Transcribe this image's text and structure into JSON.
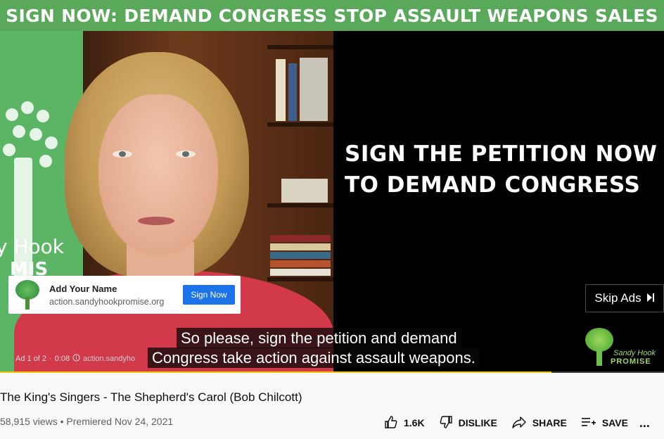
{
  "video": {
    "banner": "SIGN NOW: DEMAND CONGRESS STOP ASSAULT WEAPONS SALES",
    "petition_line1": "SIGN THE PETITION NOW",
    "petition_line2": "TO DEMAND CONGRESS",
    "panel_text1": "y Hook",
    "panel_text2": "MIS",
    "captions": [
      "So please, sign the petition and demand",
      "Congress take action against assault weapons."
    ],
    "progress": 0.83,
    "ad_info": {
      "counter": "Ad 1 of 2",
      "time": "0:08",
      "url": "action.sandyho"
    },
    "overlay_ad": {
      "title": "Add Your Name",
      "url": "action.sandyhookpromise.org",
      "button": "Sign Now"
    },
    "skip": {
      "label": "Skip Ads",
      "icon": "skip-next-icon"
    },
    "brand": {
      "line1": "Sandy Hook",
      "line2": "PROMISE"
    }
  },
  "info": {
    "title": "The King's Singers - The Shepherd's Carol (Bob Chilcott)",
    "views": "58,915 views",
    "premiered": "Premiered Nov 24, 2021",
    "likes": "1.6K",
    "dislike": "DISLIKE",
    "share": "SHARE",
    "save": "SAVE",
    "more": "..."
  },
  "colors": {
    "banner": "#5aa95a",
    "progress": "#f2c30f",
    "ad_button": "#1a73e8"
  }
}
